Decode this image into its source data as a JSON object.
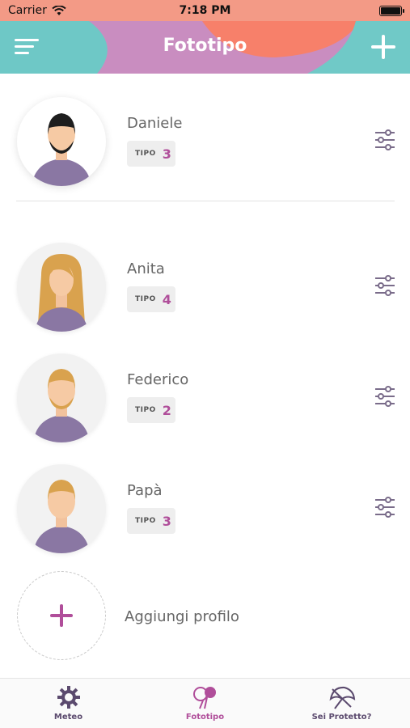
{
  "status_bar": {
    "carrier": "Carrier",
    "time": "7:18 PM"
  },
  "header": {
    "title": "Fototipo"
  },
  "profiles": [
    {
      "name": "Daniele",
      "tipo_label": "TIPO",
      "tipo_value": "3"
    },
    {
      "name": "Anita",
      "tipo_label": "TIPO",
      "tipo_value": "4"
    },
    {
      "name": "Federico",
      "tipo_label": "TIPO",
      "tipo_value": "2"
    },
    {
      "name": "Papà",
      "tipo_label": "TIPO",
      "tipo_value": "3"
    }
  ],
  "add_profile": {
    "label": "Aggiungi profilo"
  },
  "tabs": [
    {
      "label": "Meteo",
      "icon": "sun-gear-icon",
      "active": false
    },
    {
      "label": "Fototipo",
      "icon": "lollipop-icon",
      "active": true
    },
    {
      "label": "Sei Protetto?",
      "icon": "umbrella-icon",
      "active": false
    }
  ],
  "colors": {
    "accent": "#b04e9a",
    "tab_inactive": "#5b4a6e",
    "status_bar": "#f39a86"
  }
}
